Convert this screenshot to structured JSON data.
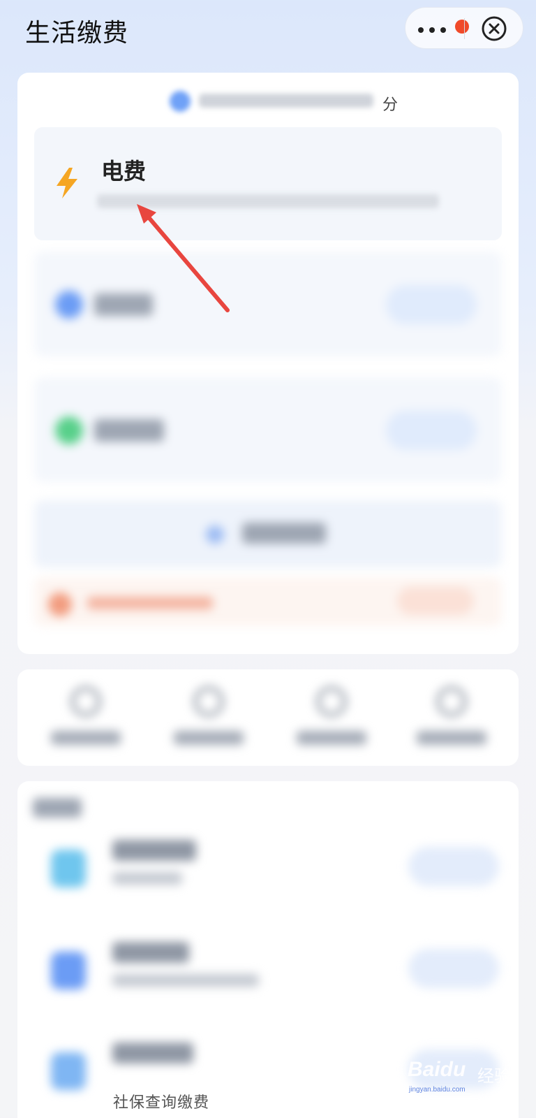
{
  "header": {
    "title": "生活缴费",
    "more_icon": "more-dots-icon",
    "close_icon": "close-circle-icon",
    "notification_color": "#f04a2a"
  },
  "points": {
    "suffix": "分"
  },
  "electricity": {
    "title": "电费",
    "icon": "lightning-bolt-icon",
    "icon_color": "#f5a623"
  },
  "recommend": {
    "last_item_label": "社保查询缴费"
  },
  "watermark": {
    "brand": "Baidu",
    "suffix": "经验",
    "url": "jingyan.baidu.com"
  },
  "annotation": {
    "arrow_color": "#e8463f"
  }
}
